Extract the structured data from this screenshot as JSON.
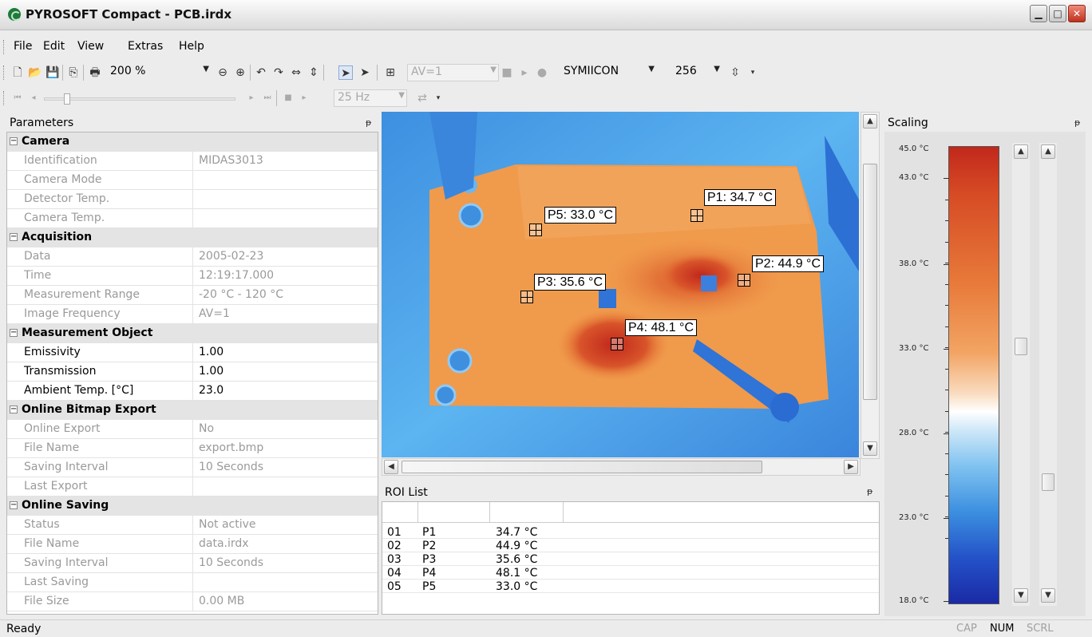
{
  "window": {
    "title": "PYROSOFT Compact - PCB.irdx"
  },
  "menu": [
    "File",
    "Edit",
    "View",
    "Extras",
    "Help"
  ],
  "toolbar": {
    "zoom": "200 %",
    "av": "AV=1",
    "palette": "SYMIICON",
    "colors": "256",
    "frequency": "25 Hz"
  },
  "params": {
    "title": "Parameters",
    "categories": [
      {
        "name": "Camera",
        "rows": [
          {
            "k": "Identification",
            "v": "MIDAS3013"
          },
          {
            "k": "Camera Mode",
            "v": ""
          },
          {
            "k": "Detector Temp.",
            "v": ""
          },
          {
            "k": "Camera Temp.",
            "v": ""
          }
        ]
      },
      {
        "name": "Acquisition",
        "rows": [
          {
            "k": "Data",
            "v": "2005-02-23"
          },
          {
            "k": "Time",
            "v": "12:19:17.000"
          },
          {
            "k": "Measurement Range",
            "v": "-20 °C - 120 °C"
          },
          {
            "k": "Image Frequency",
            "v": "AV=1"
          }
        ]
      },
      {
        "name": "Measurement Object",
        "rows": [
          {
            "k": "Emissivity",
            "v": "1.00"
          },
          {
            "k": "Transmission",
            "v": "1.00"
          },
          {
            "k": "Ambient Temp. [°C]",
            "v": "23.0"
          }
        ]
      },
      {
        "name": "Online Bitmap Export",
        "rows": [
          {
            "k": "Online Export",
            "v": "No"
          },
          {
            "k": "File Name",
            "v": "export.bmp"
          },
          {
            "k": "Saving Interval",
            "v": "10 Seconds"
          },
          {
            "k": "Last Export",
            "v": ""
          }
        ]
      },
      {
        "name": "Online Saving",
        "rows": [
          {
            "k": "Status",
            "v": "Not active"
          },
          {
            "k": "File Name",
            "v": "data.irdx"
          },
          {
            "k": "Saving Interval",
            "v": "10 Seconds"
          },
          {
            "k": "Last Saving",
            "v": ""
          },
          {
            "k": "File Size",
            "v": "0.00 MB"
          }
        ]
      }
    ]
  },
  "image": {
    "points": [
      {
        "label": "P1: 34.7 °C"
      },
      {
        "label": "P2: 44.9 °C"
      },
      {
        "label": "P3: 35.6 °C"
      },
      {
        "label": "P4: 48.1 °C"
      },
      {
        "label": "P5: 33.0 °C"
      }
    ]
  },
  "roi": {
    "title": "ROI List",
    "rows": [
      {
        "id": "01",
        "name": "P1",
        "temp": "34.7 °C"
      },
      {
        "id": "02",
        "name": "P2",
        "temp": "44.9 °C"
      },
      {
        "id": "03",
        "name": "P3",
        "temp": "35.6 °C"
      },
      {
        "id": "04",
        "name": "P4",
        "temp": "48.1 °C"
      },
      {
        "id": "05",
        "name": "P5",
        "temp": "33.0 °C"
      }
    ]
  },
  "scaling": {
    "title": "Scaling",
    "ticks": [
      "45.0 °C",
      "43.0 °C",
      "38.0 °C",
      "33.0 °C",
      "28.0 °C",
      "23.0 °C",
      "18.0 °C"
    ]
  },
  "status": {
    "text": "Ready",
    "cap": "CAP",
    "num": "NUM",
    "scrl": "SCRL"
  },
  "colors": {
    "hot": "#c1281c",
    "cold": "#1a2aa6",
    "window_accent": "#c0301e"
  }
}
